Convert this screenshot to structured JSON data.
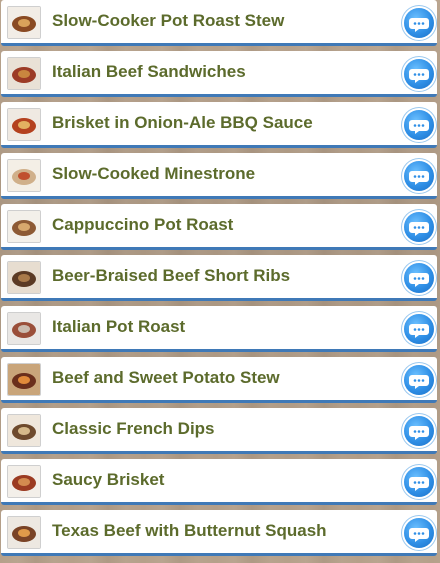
{
  "recipes": [
    {
      "title": "Slow-Cooker Pot Roast Stew",
      "thumb": [
        "#f2ede6",
        "#8a4a22",
        "#d9a25a"
      ]
    },
    {
      "title": "Italian Beef Sandwiches",
      "thumb": [
        "#e9e1d6",
        "#9c3b26",
        "#c9863f"
      ]
    },
    {
      "title": "Brisket in Onion-Ale BBQ Sauce",
      "thumb": [
        "#efe9e2",
        "#b4411f",
        "#e3b061"
      ]
    },
    {
      "title": "Slow-Cooked Minestrone",
      "thumb": [
        "#f4efe6",
        "#d0b08a",
        "#c0502e"
      ]
    },
    {
      "title": "Cappuccino Pot Roast",
      "thumb": [
        "#f3f0ea",
        "#8d5a35",
        "#d7a86e"
      ]
    },
    {
      "title": "Beer-Braised Beef Short Ribs",
      "thumb": [
        "#e7ddd0",
        "#5b3a24",
        "#a97a4a"
      ]
    },
    {
      "title": "Italian Pot Roast",
      "thumb": [
        "#e9e7e5",
        "#9a4f3a",
        "#cbbcb0"
      ]
    },
    {
      "title": "Beef and Sweet Potato Stew",
      "thumb": [
        "#c9a57a",
        "#6a2f1c",
        "#e08a3a"
      ]
    },
    {
      "title": "Classic French Dips",
      "thumb": [
        "#efe7dc",
        "#6e4a2d",
        "#d6b98a"
      ]
    },
    {
      "title": "Saucy Brisket",
      "thumb": [
        "#f3efe9",
        "#9b3b22",
        "#d38a4f"
      ]
    },
    {
      "title": "Texas Beef with Butternut Squash",
      "thumb": [
        "#ede8e1",
        "#7a4326",
        "#e09a4a"
      ]
    }
  ]
}
